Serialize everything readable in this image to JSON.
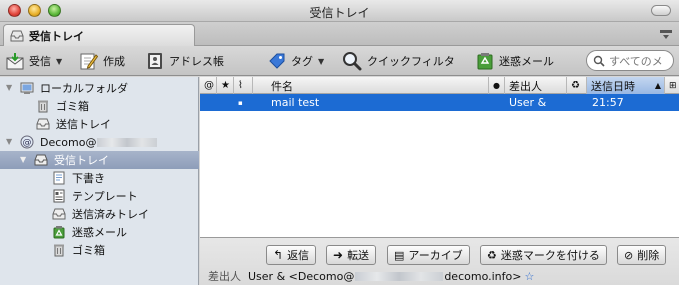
{
  "window": {
    "title": "受信トレイ"
  },
  "tab": {
    "label": "受信トレイ"
  },
  "toolbar": {
    "get_label": "受信",
    "compose_label": "作成",
    "addressbook_label": "アドレス帳",
    "tag_label": "タグ",
    "quickfilter_label": "クイックフィルタ",
    "junk_label": "迷惑メール",
    "search_placeholder": "すべてのメ"
  },
  "folders": {
    "local": {
      "label": "ローカルフォルダ",
      "trash": "ゴミ箱",
      "outbox": "送信トレイ"
    },
    "account": {
      "prefix": "Decomo@",
      "inbox": "受信トレイ",
      "drafts": "下書き",
      "templates": "テンプレート",
      "sent": "送信済みトレイ",
      "junk": "迷惑メール",
      "trash": "ゴミ箱"
    }
  },
  "columns": {
    "subject": "件名",
    "sender": "差出人",
    "date": "送信日時"
  },
  "messages": [
    {
      "subject": "mail test",
      "sender": "User &",
      "date": "21:57"
    }
  ],
  "message_header": {
    "reply": "返信",
    "forward": "転送",
    "archive": "アーカイブ",
    "junk": "迷惑マークを付ける",
    "delete": "削除",
    "from_label": "差出人",
    "from_prefix": "User & <Decomo@",
    "from_suffix": "decomo.info>"
  },
  "colors": {
    "selection": "#1c6bd3",
    "folder_pane": "#dfe5ec",
    "folder_selected": "#98a6c0"
  }
}
